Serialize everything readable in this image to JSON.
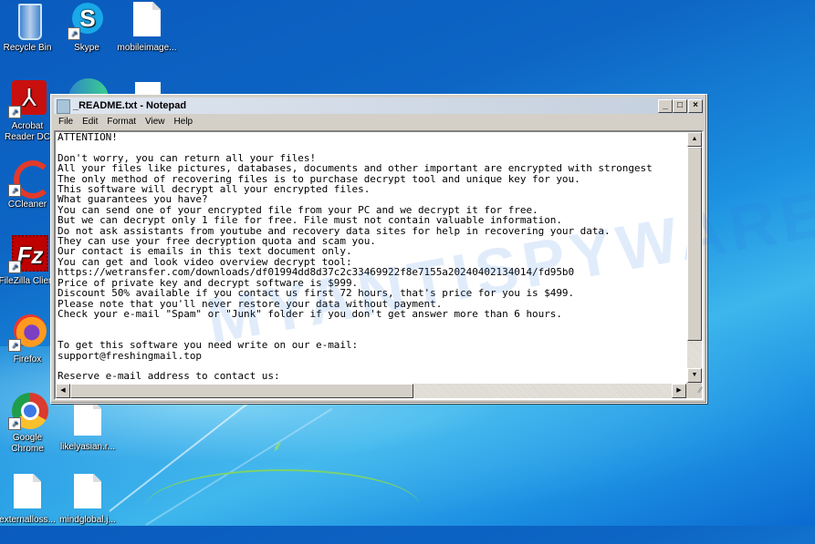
{
  "desktop": {
    "icons": [
      {
        "label": "Recycle Bin",
        "icon": "recycle-bin-icon"
      },
      {
        "label": "Skype",
        "icon": "skype-icon"
      },
      {
        "label": "mobileimage...",
        "icon": "file-icon"
      },
      {
        "label": "Acrobat Reader DC",
        "icon": "acrobat-icon"
      },
      {
        "label": "CCleaner",
        "icon": "ccleaner-icon"
      },
      {
        "label": "FileZilla Client",
        "icon": "filezilla-icon"
      },
      {
        "label": "Firefox",
        "icon": "firefox-icon"
      },
      {
        "label": "Google Chrome",
        "icon": "chrome-icon"
      },
      {
        "label": "likelyasian.r...",
        "icon": "file-icon"
      },
      {
        "label": "externalloss...",
        "icon": "file-icon"
      },
      {
        "label": "mindglobal.j...",
        "icon": "file-icon"
      }
    ],
    "watermark": "MYANTISPYWARE.COM"
  },
  "notepad": {
    "title": "_README.txt - Notepad",
    "controls": {
      "minimize": "_",
      "maximize": "□",
      "close": "×"
    },
    "menu": [
      "File",
      "Edit",
      "Format",
      "View",
      "Help"
    ],
    "content": [
      "ATTENTION!",
      "",
      "Don't worry, you can return all your files!",
      "All your files like pictures, databases, documents and other important are encrypted with strongest",
      "The only method of recovering files is to purchase decrypt tool and unique key for you.",
      "This software will decrypt all your encrypted files.",
      "What guarantees you have?",
      "You can send one of your encrypted file from your PC and we decrypt it for free.",
      "But we can decrypt only 1 file for free. File must not contain valuable information.",
      "Do not ask assistants from youtube and recovery data sites for help in recovering your data.",
      "They can use your free decryption quota and scam you.",
      "Our contact is emails in this text document only.",
      "You can get and look video overview decrypt tool:",
      "https://wetransfer.com/downloads/df01994dd8d37c2c33469922f8e7155a20240402134014/fd95b0",
      "Price of private key and decrypt software is $999.",
      "Discount 50% available if you contact us first 72 hours, that's price for you is $499.",
      "Please note that you'll never restore your data without payment.",
      "Check your e-mail \"Spam\" or \"Junk\" folder if you don't get answer more than 6 hours.",
      "",
      "",
      "To get this software you need write on our e-mail:",
      "support@freshingmail.top",
      "",
      "Reserve e-mail address to contact us:"
    ],
    "vertical_scroll_position": 0,
    "horizontal_scroll_position": 0
  }
}
